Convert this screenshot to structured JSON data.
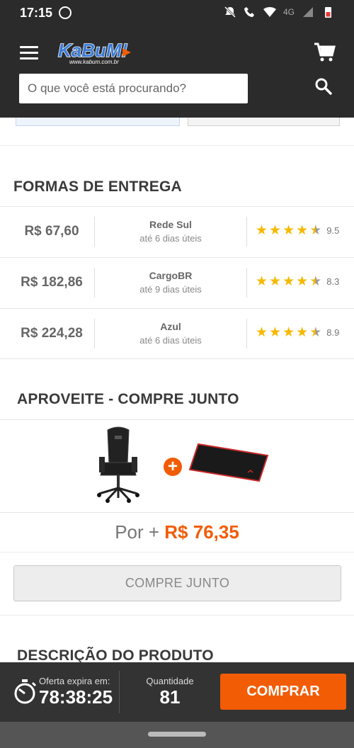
{
  "status_bar": {
    "time": "17:15",
    "network": "4G"
  },
  "header": {
    "logo_text": "KaBuM!",
    "logo_sub": "www.kabum.com.br",
    "search_placeholder": "O que você está procurando?"
  },
  "delivery": {
    "title": "FORMAS DE ENTREGA",
    "options": [
      {
        "price": "R$ 67,60",
        "carrier": "Rede Sul",
        "days": "até 6 dias úteis",
        "rating": "9.5"
      },
      {
        "price": "R$ 182,86",
        "carrier": "CargoBR",
        "days": "até 9 dias úteis",
        "rating": "8.3"
      },
      {
        "price": "R$ 224,28",
        "carrier": "Azul",
        "days": "até 6 dias úteis",
        "rating": "8.9"
      }
    ]
  },
  "combo": {
    "title": "APROVEITE - COMPRE JUNTO",
    "price_prefix": "Por + ",
    "price_value": "R$ 76,35",
    "button_label": "COMPRE JUNTO"
  },
  "description": {
    "title": "DESCRIÇÃO DO PRODUTO"
  },
  "footer": {
    "timer_label": "Oferta expira em:",
    "timer_value": "78:38:25",
    "qty_label": "Quantidade",
    "qty_value": "81",
    "buy_label": "COMPRAR"
  },
  "colors": {
    "accent": "#f25c05",
    "header_bg": "#2b2b2b",
    "star": "#f6b900"
  }
}
